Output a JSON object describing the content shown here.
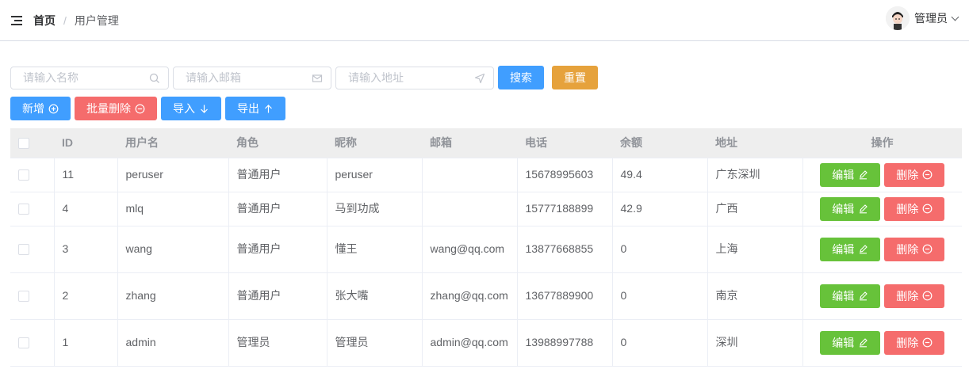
{
  "header": {
    "breadcrumb_home": "首页",
    "breadcrumb_sep": "/",
    "breadcrumb_current": "用户管理",
    "user_name": "管理员"
  },
  "search": {
    "name_placeholder": "请输入名称",
    "email_placeholder": "请输入邮箱",
    "address_placeholder": "请输入地址",
    "search_label": "搜索",
    "reset_label": "重置"
  },
  "actions": {
    "add_label": "新增",
    "batch_delete_label": "批量删除",
    "import_label": "导入",
    "export_label": "导出"
  },
  "table": {
    "columns": [
      "ID",
      "用户名",
      "角色",
      "昵称",
      "邮箱",
      "电话",
      "余额",
      "地址",
      "操作"
    ],
    "edit_label": "编辑",
    "delete_label": "删除",
    "rows": [
      {
        "id": "11",
        "username": "peruser",
        "role": "普通用户",
        "nickname": "peruser",
        "email": "",
        "phone": "15678995603",
        "balance": "49.4",
        "address": "广东深圳"
      },
      {
        "id": "4",
        "username": "mlq",
        "role": "普通用户",
        "nickname": "马到功成",
        "email": "",
        "phone": "15777188899",
        "balance": "42.9",
        "address": "广西"
      },
      {
        "id": "3",
        "username": "wang",
        "role": "普通用户",
        "nickname": "懂王",
        "email": "wang@qq.com",
        "phone": "13877668855",
        "balance": "0",
        "address": "上海"
      },
      {
        "id": "2",
        "username": "zhang",
        "role": "普通用户",
        "nickname": "张大嘴",
        "email": "zhang@qq.com",
        "phone": "13677889900",
        "balance": "0",
        "address": "南京"
      },
      {
        "id": "1",
        "username": "admin",
        "role": "管理员",
        "nickname": "管理员",
        "email": "admin@qq.com",
        "phone": "13988997788",
        "balance": "0",
        "address": "深圳"
      }
    ]
  },
  "colors": {
    "primary": "#409eff",
    "success": "#67c23a",
    "warning": "#e6a23c",
    "danger": "#f56c6c"
  }
}
